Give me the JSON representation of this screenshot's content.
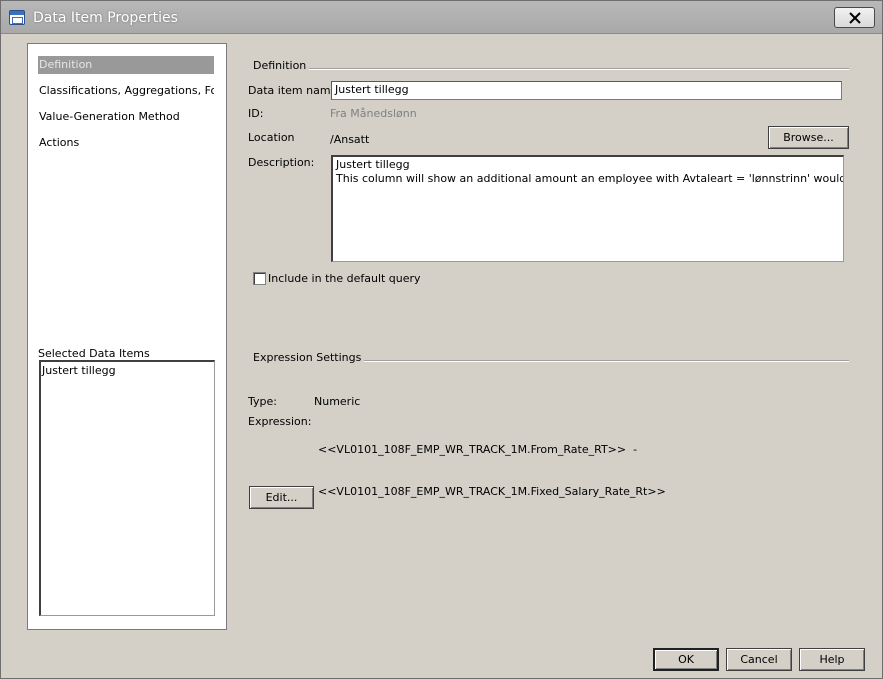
{
  "window": {
    "title": "Data Item Properties",
    "close_symbol": "✕"
  },
  "nav": {
    "items": [
      {
        "label": "Definition",
        "selected": true
      },
      {
        "label": "Classifications, Aggregations, For..."
      },
      {
        "label": "Value-Generation Method"
      },
      {
        "label": "Actions"
      }
    ],
    "selected_items_label": "Selected Data Items",
    "selected_items": [
      "Justert tillegg"
    ]
  },
  "definition": {
    "group_title": "Definition",
    "name_label": "Data item name:",
    "name_value": "Justert tillegg",
    "id_label": "ID:",
    "id_value": "Fra Månedslønn",
    "location_label": "Location",
    "location_value": "/Ansatt",
    "browse_label": "Browse...",
    "description_label": "Description:",
    "description_lines": [
      "Justert tillegg",
      "This column will show an additional amount an employee with Avtaleart = 'lønnstrinn' would be getting."
    ],
    "include_default_label": "Include in the default query",
    "include_default_checked": false
  },
  "expression": {
    "group_title": "Expression Settings",
    "type_label": "Type:",
    "type_value": "Numeric",
    "expression_label": "Expression:",
    "expression_lines": [
      "<<VL0101_108F_EMP_WR_TRACK_1M.From_Rate_RT>>  -",
      "<<VL0101_108F_EMP_WR_TRACK_1M.Fixed_Salary_Rate_Rt>>"
    ],
    "edit_label": "Edit..."
  },
  "footer": {
    "ok_label": "OK",
    "cancel_label": "Cancel",
    "help_label": "Help"
  }
}
